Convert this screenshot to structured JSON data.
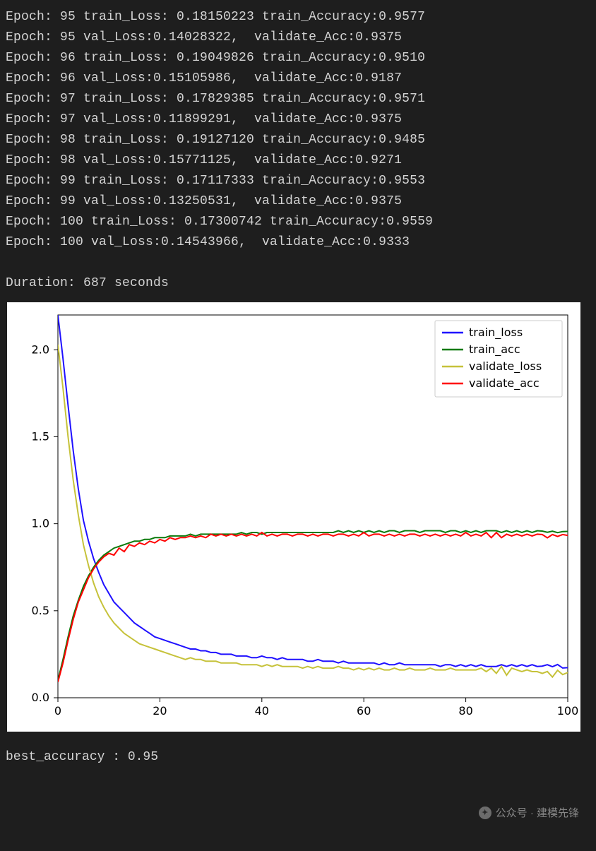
{
  "log_lines": [
    "Epoch: 95 train_Loss: 0.18150223 train_Accuracy:0.9577",
    "Epoch: 95 val_Loss:0.14028322,  validate_Acc:0.9375",
    "Epoch: 96 train_Loss: 0.19049826 train_Accuracy:0.9510",
    "Epoch: 96 val_Loss:0.15105986,  validate_Acc:0.9187",
    "Epoch: 97 train_Loss: 0.17829385 train_Accuracy:0.9571",
    "Epoch: 97 val_Loss:0.11899291,  validate_Acc:0.9375",
    "Epoch: 98 train_Loss: 0.19127120 train_Accuracy:0.9485",
    "Epoch: 98 val_Loss:0.15771125,  validate_Acc:0.9271",
    "Epoch: 99 train_Loss: 0.17117333 train_Accuracy:0.9553",
    "Epoch: 99 val_Loss:0.13250531,  validate_Acc:0.9375",
    "Epoch: 100 train_Loss: 0.17300742 train_Accuracy:0.9559",
    "Epoch: 100 val_Loss:0.14543966,  validate_Acc:0.9333"
  ],
  "duration_line": "Duration: 687 seconds",
  "best_line": "best_accuracy : 0.95",
  "watermark": "公众号 · 建模先锋",
  "chart_data": {
    "type": "line",
    "title": "",
    "xlabel": "",
    "ylabel": "",
    "xlim": [
      0,
      100
    ],
    "ylim": [
      0.0,
      2.2
    ],
    "xticks": [
      0,
      20,
      40,
      60,
      80,
      100
    ],
    "yticks": [
      0.0,
      0.5,
      1.0,
      1.5,
      2.0
    ],
    "legend_position": "upper right",
    "x": [
      0,
      1,
      2,
      3,
      4,
      5,
      6,
      7,
      8,
      9,
      10,
      11,
      12,
      13,
      14,
      15,
      16,
      17,
      18,
      19,
      20,
      21,
      22,
      23,
      24,
      25,
      26,
      27,
      28,
      29,
      30,
      31,
      32,
      33,
      34,
      35,
      36,
      37,
      38,
      39,
      40,
      41,
      42,
      43,
      44,
      45,
      46,
      47,
      48,
      49,
      50,
      51,
      52,
      53,
      54,
      55,
      56,
      57,
      58,
      59,
      60,
      61,
      62,
      63,
      64,
      65,
      66,
      67,
      68,
      69,
      70,
      71,
      72,
      73,
      74,
      75,
      76,
      77,
      78,
      79,
      80,
      81,
      82,
      83,
      84,
      85,
      86,
      87,
      88,
      89,
      90,
      91,
      92,
      93,
      94,
      95,
      96,
      97,
      98,
      99,
      100
    ],
    "series": [
      {
        "name": "train_loss",
        "color": "#1f10ff",
        "values": [
          2.2,
          1.95,
          1.68,
          1.42,
          1.2,
          1.02,
          0.9,
          0.8,
          0.72,
          0.65,
          0.6,
          0.55,
          0.52,
          0.49,
          0.46,
          0.43,
          0.41,
          0.39,
          0.37,
          0.35,
          0.34,
          0.33,
          0.32,
          0.31,
          0.3,
          0.29,
          0.28,
          0.28,
          0.27,
          0.27,
          0.26,
          0.26,
          0.25,
          0.25,
          0.25,
          0.24,
          0.24,
          0.24,
          0.23,
          0.23,
          0.24,
          0.23,
          0.23,
          0.22,
          0.23,
          0.22,
          0.22,
          0.22,
          0.22,
          0.21,
          0.21,
          0.22,
          0.21,
          0.21,
          0.21,
          0.2,
          0.21,
          0.2,
          0.2,
          0.2,
          0.2,
          0.2,
          0.2,
          0.19,
          0.2,
          0.19,
          0.19,
          0.2,
          0.19,
          0.19,
          0.19,
          0.19,
          0.19,
          0.19,
          0.19,
          0.18,
          0.19,
          0.19,
          0.18,
          0.19,
          0.18,
          0.19,
          0.18,
          0.19,
          0.18,
          0.18,
          0.18,
          0.19,
          0.18,
          0.19,
          0.18,
          0.19,
          0.18,
          0.19,
          0.18,
          0.182,
          0.19,
          0.178,
          0.191,
          0.171,
          0.173
        ]
      },
      {
        "name": "train_acc",
        "color": "#0b7a0b",
        "values": [
          0.1,
          0.22,
          0.35,
          0.47,
          0.56,
          0.64,
          0.7,
          0.75,
          0.79,
          0.82,
          0.84,
          0.86,
          0.87,
          0.88,
          0.89,
          0.9,
          0.9,
          0.91,
          0.91,
          0.92,
          0.92,
          0.92,
          0.93,
          0.93,
          0.93,
          0.93,
          0.94,
          0.93,
          0.94,
          0.94,
          0.94,
          0.94,
          0.94,
          0.94,
          0.94,
          0.94,
          0.95,
          0.94,
          0.95,
          0.95,
          0.94,
          0.95,
          0.95,
          0.95,
          0.95,
          0.95,
          0.95,
          0.95,
          0.95,
          0.95,
          0.95,
          0.95,
          0.95,
          0.95,
          0.95,
          0.96,
          0.95,
          0.96,
          0.95,
          0.96,
          0.95,
          0.96,
          0.95,
          0.96,
          0.95,
          0.96,
          0.96,
          0.95,
          0.96,
          0.96,
          0.96,
          0.95,
          0.96,
          0.96,
          0.96,
          0.96,
          0.95,
          0.96,
          0.96,
          0.95,
          0.96,
          0.95,
          0.96,
          0.95,
          0.96,
          0.96,
          0.96,
          0.95,
          0.96,
          0.95,
          0.96,
          0.95,
          0.96,
          0.95,
          0.96,
          0.958,
          0.951,
          0.957,
          0.949,
          0.955,
          0.956
        ]
      },
      {
        "name": "validate_loss",
        "color": "#c6c23a",
        "values": [
          2.03,
          1.78,
          1.5,
          1.25,
          1.05,
          0.88,
          0.76,
          0.66,
          0.58,
          0.52,
          0.47,
          0.43,
          0.4,
          0.37,
          0.35,
          0.33,
          0.31,
          0.3,
          0.29,
          0.28,
          0.27,
          0.26,
          0.25,
          0.24,
          0.23,
          0.22,
          0.23,
          0.22,
          0.22,
          0.21,
          0.21,
          0.21,
          0.2,
          0.2,
          0.2,
          0.2,
          0.19,
          0.19,
          0.19,
          0.19,
          0.18,
          0.19,
          0.18,
          0.19,
          0.18,
          0.18,
          0.18,
          0.18,
          0.17,
          0.18,
          0.17,
          0.18,
          0.17,
          0.17,
          0.17,
          0.18,
          0.17,
          0.17,
          0.16,
          0.17,
          0.16,
          0.17,
          0.16,
          0.17,
          0.16,
          0.16,
          0.17,
          0.16,
          0.16,
          0.17,
          0.16,
          0.16,
          0.16,
          0.17,
          0.16,
          0.16,
          0.16,
          0.17,
          0.16,
          0.16,
          0.16,
          0.16,
          0.16,
          0.17,
          0.15,
          0.17,
          0.14,
          0.18,
          0.13,
          0.17,
          0.16,
          0.15,
          0.16,
          0.15,
          0.15,
          0.14,
          0.151,
          0.119,
          0.158,
          0.133,
          0.145
        ]
      },
      {
        "name": "validate_acc",
        "color": "#ff0000",
        "values": [
          0.09,
          0.2,
          0.33,
          0.45,
          0.55,
          0.62,
          0.69,
          0.74,
          0.78,
          0.81,
          0.83,
          0.82,
          0.86,
          0.84,
          0.88,
          0.87,
          0.89,
          0.88,
          0.9,
          0.89,
          0.91,
          0.9,
          0.92,
          0.91,
          0.92,
          0.92,
          0.93,
          0.92,
          0.93,
          0.92,
          0.94,
          0.93,
          0.94,
          0.93,
          0.94,
          0.93,
          0.94,
          0.93,
          0.94,
          0.93,
          0.95,
          0.93,
          0.94,
          0.93,
          0.94,
          0.94,
          0.93,
          0.94,
          0.94,
          0.93,
          0.94,
          0.93,
          0.94,
          0.94,
          0.93,
          0.94,
          0.94,
          0.93,
          0.94,
          0.93,
          0.95,
          0.93,
          0.94,
          0.94,
          0.93,
          0.94,
          0.93,
          0.94,
          0.93,
          0.94,
          0.94,
          0.93,
          0.94,
          0.93,
          0.94,
          0.93,
          0.94,
          0.93,
          0.94,
          0.93,
          0.95,
          0.93,
          0.94,
          0.93,
          0.95,
          0.92,
          0.95,
          0.92,
          0.94,
          0.93,
          0.94,
          0.93,
          0.94,
          0.93,
          0.94,
          0.938,
          0.919,
          0.938,
          0.927,
          0.938,
          0.933
        ]
      }
    ]
  }
}
